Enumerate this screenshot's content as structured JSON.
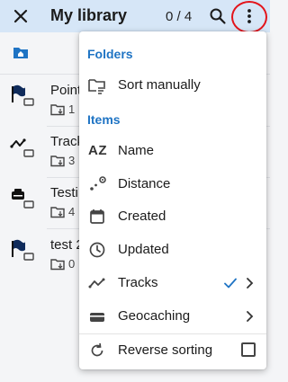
{
  "appbar": {
    "title": "My library",
    "count": "0 / 4",
    "close_icon": "close-icon",
    "search_icon": "search-icon",
    "more_icon": "more-vert-icon"
  },
  "list": {
    "items": [
      {
        "name": "Point",
        "sub": "1",
        "icon": "flag-icon"
      },
      {
        "name": "Track",
        "sub": "3",
        "icon": "track-icon"
      },
      {
        "name": "Testi",
        "sub": "4",
        "icon": "geocache-icon"
      },
      {
        "name": "test 2",
        "sub": "0",
        "icon": "flag-icon"
      }
    ]
  },
  "menu": {
    "folders_header": "Folders",
    "sort_manually": "Sort manually",
    "items_header": "Items",
    "name": "Name",
    "name_icon_text": "AZ",
    "distance": "Distance",
    "created": "Created",
    "updated": "Updated",
    "tracks": "Tracks",
    "geocaching": "Geocaching",
    "reverse_sorting": "Reverse sorting",
    "tracks_checked": true,
    "reverse_sorting_checked": false
  },
  "colors": {
    "appbar_bg": "#d6e6f7",
    "accent": "#1f74c4",
    "highlight": "#e3141b"
  }
}
